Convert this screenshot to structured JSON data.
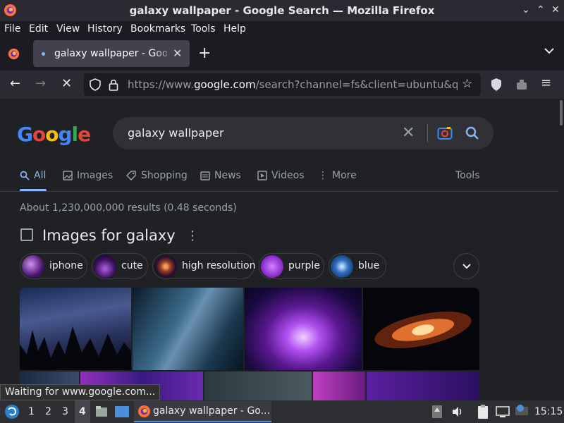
{
  "window": {
    "title": "galaxy wallpaper - Google Search — Mozilla Firefox"
  },
  "menubar": {
    "items": [
      "File",
      "Edit",
      "View",
      "History",
      "Bookmarks",
      "Tools",
      "Help"
    ]
  },
  "tabs": [
    {
      "label": "galaxy wallpaper - Google Search",
      "active": true
    }
  ],
  "urlbar": {
    "prefix": "https://www.",
    "domain": "google.com",
    "rest": "/search?channel=fs&client=ubuntu&q=ga"
  },
  "google": {
    "logo": "Google",
    "query": "galaxy wallpaper",
    "tabs": [
      {
        "label": "All",
        "icon": "search-icon",
        "active": true
      },
      {
        "label": "Images",
        "icon": "image-icon"
      },
      {
        "label": "Shopping",
        "icon": "tag-icon"
      },
      {
        "label": "News",
        "icon": "news-icon"
      },
      {
        "label": "Videos",
        "icon": "play-icon"
      },
      {
        "label": "More",
        "icon": "more-vert-icon"
      }
    ],
    "tools_label": "Tools",
    "stats": "About 1,230,000,000 results (0.48 seconds)",
    "images_heading": "Images for galaxy",
    "chips": [
      {
        "label": "iphone",
        "color": "#7b3fa8"
      },
      {
        "label": "cute",
        "color": "#5a2a7a"
      },
      {
        "label": "high resolution",
        "color": "#8a4a30"
      },
      {
        "label": "purple",
        "color": "#a040d0"
      },
      {
        "label": "blue",
        "color": "#2a5a9a"
      }
    ]
  },
  "status": {
    "text": "Waiting for www.google.com..."
  },
  "taskbar": {
    "workspaces": [
      "1",
      "2",
      "3",
      "4"
    ],
    "active_workspace": "4",
    "task_label": "galaxy wallpaper - Go...",
    "clock": "15:15"
  },
  "colors": {
    "page_bg": "#202124",
    "accent_blue": "#8ab4f8",
    "chrome_dark": "#1c1b22"
  }
}
